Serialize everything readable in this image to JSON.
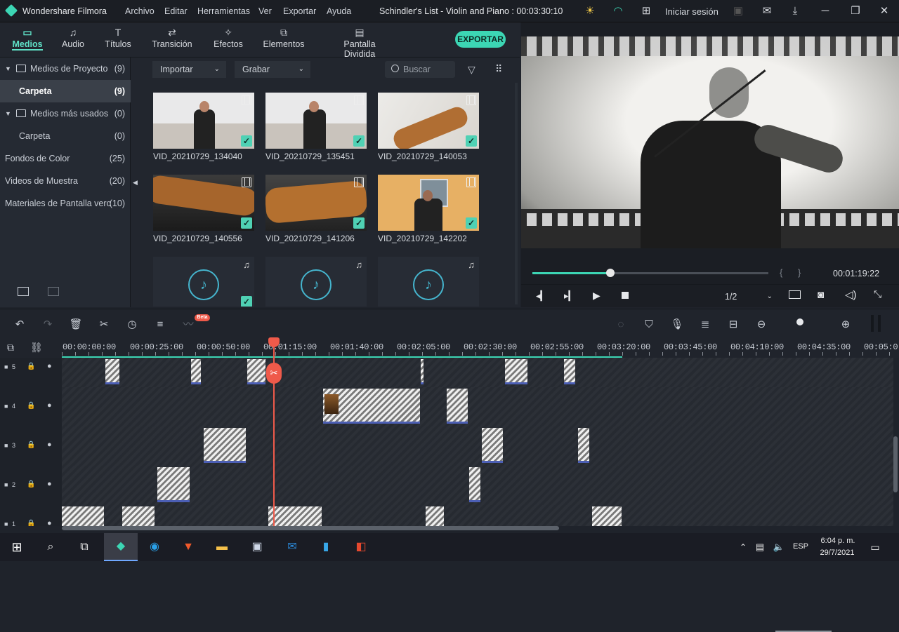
{
  "app": {
    "name": "Wondershare Filmora",
    "project_title": "Schindler's List - Violin and Piano : 00:03:30:10",
    "login": "Iniciar sesión"
  },
  "menu": [
    "Archivo",
    "Editar",
    "Herramientas",
    "Ver",
    "Exportar",
    "Ayuda"
  ],
  "tabs": [
    {
      "label": "Medios",
      "icon": "folder-icon"
    },
    {
      "label": "Audio",
      "icon": "music-note-icon"
    },
    {
      "label": "Títulos",
      "icon": "text-icon"
    },
    {
      "label": "Transición",
      "icon": "transition-icon"
    },
    {
      "label": "Efectos",
      "icon": "effects-icon"
    },
    {
      "label": "Elementos",
      "icon": "elements-icon"
    },
    {
      "label": "Pantalla Dividida",
      "icon": "split-screen-icon"
    }
  ],
  "export_label": "EXPORTAR",
  "tree": [
    {
      "label": "Medios de Proyecto",
      "count": "(9)"
    },
    {
      "label": "Carpeta",
      "count": "(9)"
    },
    {
      "label": "Medios más usados",
      "count": "(0)"
    },
    {
      "label": "Carpeta",
      "count": "(0)"
    },
    {
      "label": "Fondos de Color",
      "count": "(25)"
    },
    {
      "label": "Videos de Muestra",
      "count": "(20)"
    },
    {
      "label": "Materiales de Pantalla verc",
      "count": "(10)"
    }
  ],
  "media_toolbar": {
    "import": "Importar",
    "record": "Grabar",
    "search_placeholder": "Buscar"
  },
  "media": [
    {
      "name": "VID_20210729_134040"
    },
    {
      "name": "VID_20210729_135451"
    },
    {
      "name": "VID_20210729_140053"
    },
    {
      "name": "VID_20210729_140556"
    },
    {
      "name": "VID_20210729_141206"
    },
    {
      "name": "VID_20210729_142202"
    }
  ],
  "preview": {
    "timecode": "00:01:19:22",
    "progress": 0.33,
    "quality": "1/2",
    "brackets": "{      }"
  },
  "ruler": [
    "00:00:00:00",
    "00:00:25:00",
    "00:00:50:00",
    "00:01:15:00",
    "00:01:40:00",
    "00:02:05:00",
    "00:02:30:00",
    "00:02:55:00",
    "00:03:20:00",
    "00:03:45:00",
    "00:04:10:00",
    "00:04:35:00",
    "00:05:0"
  ],
  "tracks": [
    "5",
    "4",
    "3",
    "2",
    "1"
  ],
  "beta": "Beta",
  "taskbar": {
    "lang": "ESP",
    "time": "6:04 p. m.",
    "date": "29/7/2021"
  },
  "colors": {
    "accent": "#3cd6b4",
    "playhead": "#ef5a4a",
    "bg": "#1f232b"
  }
}
